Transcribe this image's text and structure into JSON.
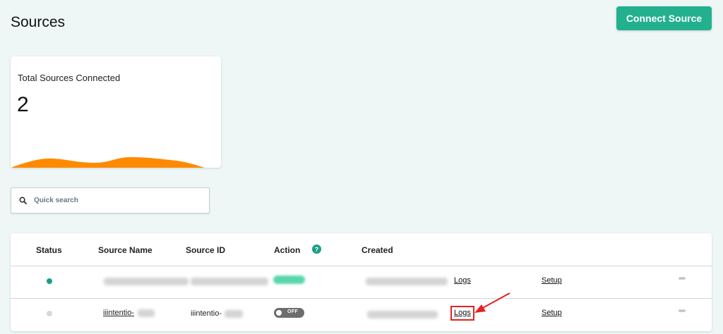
{
  "page": {
    "title": "Sources",
    "connect_button": "Connect Source"
  },
  "stat_card": {
    "label": "Total Sources Connected",
    "value": "2",
    "wave_color": "#ff8a00"
  },
  "search": {
    "placeholder": "Quick search",
    "icon": "search-icon"
  },
  "table": {
    "headers": [
      "Status",
      "Source Name",
      "Source ID",
      "Action",
      "Created"
    ],
    "action_help_icon": "help-icon",
    "rows": [
      {
        "status": "active",
        "status_color": "#1a9e86",
        "source_name": "",
        "source_id": "",
        "action": "on",
        "created": "",
        "logs_label": "Logs",
        "setup_label": "Setup",
        "more_label": "°°°"
      },
      {
        "status": "inactive",
        "status_color": "#d8d8d8",
        "source_name": "iiintentio-",
        "source_id": "iiintentio-",
        "action": "off",
        "action_label": "OFF",
        "created": "",
        "logs_label": "Logs",
        "setup_label": "Setup",
        "more_label": "°°°"
      }
    ]
  },
  "annotation": {
    "color": "#e52222",
    "target": "row-2-logs-link"
  }
}
